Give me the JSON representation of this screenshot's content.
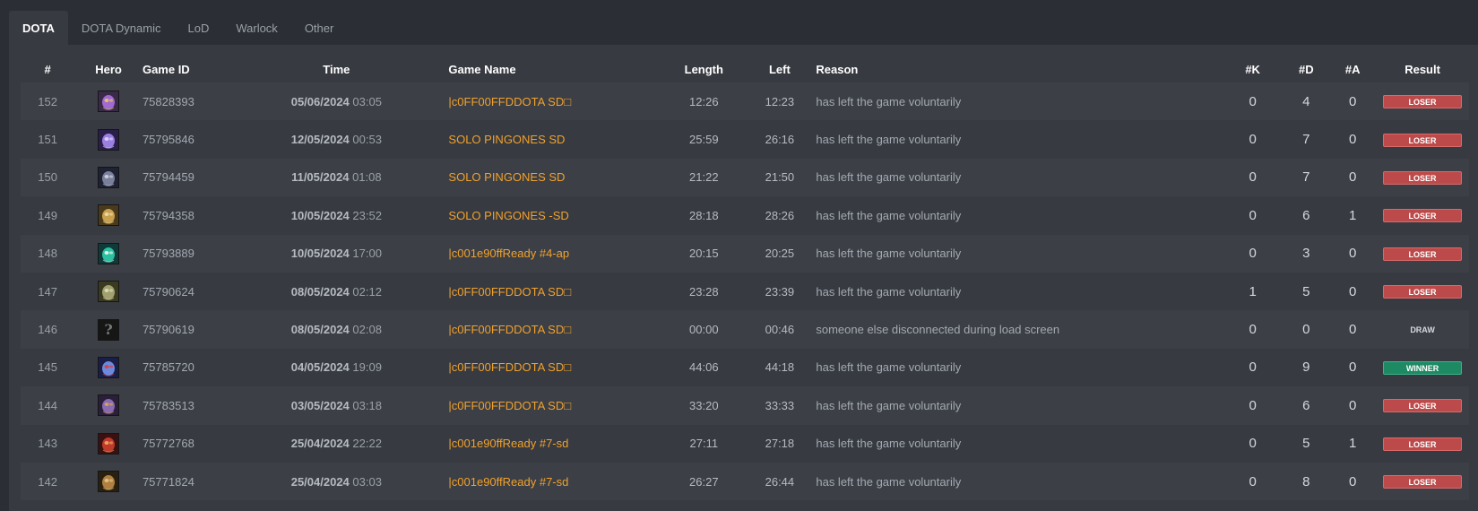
{
  "tabs": [
    "DOTA",
    "DOTA Dynamic",
    "LoD",
    "Warlock",
    "Other"
  ],
  "active_tab": "DOTA",
  "columns": [
    "#",
    "Hero",
    "Game ID",
    "Time",
    "Game Name",
    "Length",
    "Left",
    "Reason",
    "#K",
    "#D",
    "#A",
    "Result"
  ],
  "colors": {
    "loser": "#bd4a4a",
    "winner": "#1e8a64",
    "game_name": "#f0a12c"
  },
  "rows": [
    {
      "num": "152",
      "hero": {
        "icon": "hero-portrait-purple-beast",
        "colors": [
          "#3a2a4a",
          "#a06ad0",
          "#e0c070"
        ]
      },
      "game_id": "75828393",
      "date": "05/06/2024",
      "time": "03:05",
      "game_name": "|c0FF00FFDDOTA SD□",
      "length": "12:26",
      "left": "12:23",
      "reason": "has left the game voluntarily",
      "k": "0",
      "d": "4",
      "a": "0",
      "result": "LOSER"
    },
    {
      "num": "151",
      "hero": {
        "icon": "hero-portrait-purple-face",
        "colors": [
          "#2a1f4a",
          "#9b7fe0",
          "#d6ccff"
        ]
      },
      "game_id": "75795846",
      "date": "12/05/2024",
      "time": "00:53",
      "game_name": "SOLO PINGONES SD",
      "length": "25:59",
      "left": "26:16",
      "reason": "has left the game voluntarily",
      "k": "0",
      "d": "7",
      "a": "0",
      "result": "LOSER"
    },
    {
      "num": "150",
      "hero": {
        "icon": "hero-portrait-hooded-grey",
        "colors": [
          "#1f2233",
          "#7a7f9a",
          "#c8cce0"
        ]
      },
      "game_id": "75794459",
      "date": "11/05/2024",
      "time": "01:08",
      "game_name": "SOLO PINGONES SD",
      "length": "21:22",
      "left": "21:50",
      "reason": "has left the game voluntarily",
      "k": "0",
      "d": "7",
      "a": "0",
      "result": "LOSER"
    },
    {
      "num": "149",
      "hero": {
        "icon": "hero-portrait-golden-beast",
        "colors": [
          "#4a3a1a",
          "#c8a050",
          "#e8d8a0"
        ]
      },
      "game_id": "75794358",
      "date": "10/05/2024",
      "time": "23:52",
      "game_name": "SOLO PINGONES -SD",
      "length": "28:18",
      "left": "28:26",
      "reason": "has left the game voluntarily",
      "k": "0",
      "d": "6",
      "a": "1",
      "result": "LOSER"
    },
    {
      "num": "148",
      "hero": {
        "icon": "hero-portrait-teal-dragon",
        "colors": [
          "#0f3a3a",
          "#2ac0a0",
          "#e0f0e8"
        ]
      },
      "game_id": "75793889",
      "date": "10/05/2024",
      "time": "17:00",
      "game_name": "|c001e90ffReady #4-ap",
      "length": "20:15",
      "left": "20:25",
      "reason": "has left the game voluntarily",
      "k": "0",
      "d": "3",
      "a": "0",
      "result": "LOSER"
    },
    {
      "num": "147",
      "hero": {
        "icon": "hero-portrait-olive-creature",
        "colors": [
          "#3a3a20",
          "#a0a070",
          "#d8d8b0"
        ]
      },
      "game_id": "75790624",
      "date": "08/05/2024",
      "time": "02:12",
      "game_name": "|c0FF00FFDDOTA SD□",
      "length": "23:28",
      "left": "23:39",
      "reason": "has left the game voluntarily",
      "k": "1",
      "d": "5",
      "a": "0",
      "result": "LOSER"
    },
    {
      "num": "146",
      "hero": {
        "icon": "unknown-hero-icon",
        "glyph": "?"
      },
      "game_id": "75790619",
      "date": "08/05/2024",
      "time": "02:08",
      "game_name": "|c0FF00FFDDOTA SD□",
      "length": "00:00",
      "left": "00:46",
      "reason": "someone else disconnected during load screen",
      "k": "0",
      "d": "0",
      "a": "0",
      "result": "DRAW"
    },
    {
      "num": "145",
      "hero": {
        "icon": "hero-portrait-blue-knight",
        "colors": [
          "#1a1f4a",
          "#6a8ae0",
          "#e04040"
        ]
      },
      "game_id": "75785720",
      "date": "04/05/2024",
      "time": "19:09",
      "game_name": "|c0FF00FFDDOTA SD□",
      "length": "44:06",
      "left": "44:18",
      "reason": "has left the game voluntarily",
      "k": "0",
      "d": "9",
      "a": "0",
      "result": "WINNER"
    },
    {
      "num": "144",
      "hero": {
        "icon": "hero-portrait-violet-warrior",
        "colors": [
          "#2a1f3a",
          "#8a6ab0",
          "#d0a060"
        ]
      },
      "game_id": "75783513",
      "date": "03/05/2024",
      "time": "03:18",
      "game_name": "|c0FF00FFDDOTA SD□",
      "length": "33:20",
      "left": "33:33",
      "reason": "has left the game voluntarily",
      "k": "0",
      "d": "6",
      "a": "0",
      "result": "LOSER"
    },
    {
      "num": "143",
      "hero": {
        "icon": "hero-portrait-red-demon",
        "colors": [
          "#3a1010",
          "#c03a2a",
          "#e8a060"
        ]
      },
      "game_id": "75772768",
      "date": "25/04/2024",
      "time": "22:22",
      "game_name": "|c001e90ffReady #7-sd",
      "length": "27:11",
      "left": "27:18",
      "reason": "has left the game voluntarily",
      "k": "0",
      "d": "5",
      "a": "1",
      "result": "LOSER"
    },
    {
      "num": "142",
      "hero": {
        "icon": "hero-portrait-bronze-beast",
        "colors": [
          "#2a2010",
          "#b08040",
          "#e0c080"
        ]
      },
      "game_id": "75771824",
      "date": "25/04/2024",
      "time": "03:03",
      "game_name": "|c001e90ffReady #7-sd",
      "length": "26:27",
      "left": "26:44",
      "reason": "has left the game voluntarily",
      "k": "0",
      "d": "8",
      "a": "0",
      "result": "LOSER"
    }
  ]
}
